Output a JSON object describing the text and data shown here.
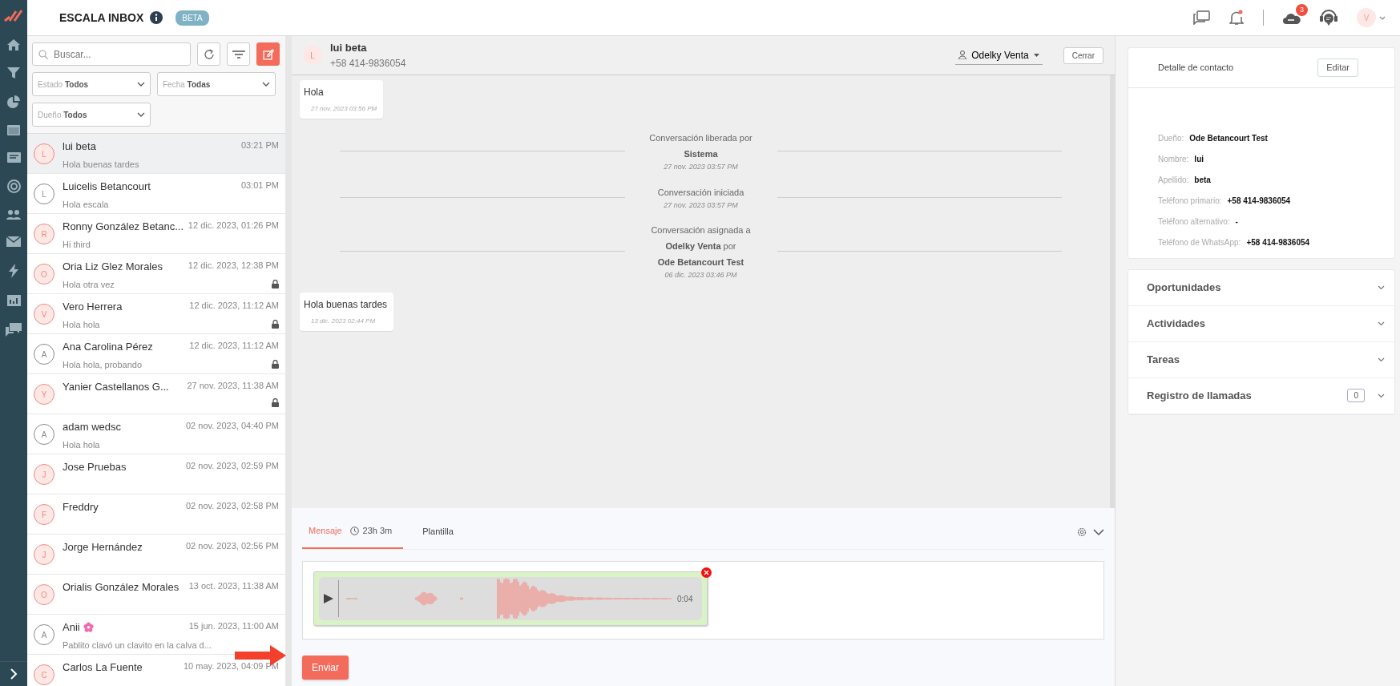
{
  "app": {
    "title": "ESCALA INBOX",
    "badge": "BETA",
    "alerts_count": "3",
    "user_initial": "V"
  },
  "conversation_list": {
    "search": {
      "placeholder": "Buscar..."
    },
    "filters": [
      {
        "label": "Estado",
        "value": "Todos"
      },
      {
        "label": "Fecha",
        "value": "Todas"
      },
      {
        "label": "Dueño",
        "value": "Todos"
      }
    ],
    "items": [
      {
        "initial": "L",
        "name": "lui beta",
        "time": "03:21 PM",
        "preview": "Hola buenas tardes",
        "color": "#f08a7e",
        "locked": false,
        "flower": false,
        "selected": true
      },
      {
        "initial": "L",
        "name": "Luicelis Betancourt",
        "time": "03:01 PM",
        "preview": "Hola escala",
        "color": "#8a8a8a",
        "locked": false,
        "flower": false,
        "selected": false
      },
      {
        "initial": "R",
        "name": "Ronny González Betanc...",
        "time": "12 dic. 2023, 01:26 PM",
        "preview": "Hi third",
        "color": "#f08a7e",
        "locked": false,
        "flower": false,
        "selected": false
      },
      {
        "initial": "O",
        "name": "Oria Liz Glez Morales",
        "time": "12 dic. 2023, 12:38 PM",
        "preview": "Hola otra vez",
        "color": "#f08a7e",
        "locked": true,
        "flower": false,
        "selected": false
      },
      {
        "initial": "V",
        "name": "Vero Herrera",
        "time": "12 dic. 2023, 11:12 AM",
        "preview": "Hola hola",
        "color": "#f08a7e",
        "locked": true,
        "flower": false,
        "selected": false
      },
      {
        "initial": "A",
        "name": "Ana Carolina Pérez",
        "time": "12 dic. 2023, 11:12 AM",
        "preview": "Hola hola, probando",
        "color": "#8a8a8a",
        "locked": true,
        "flower": false,
        "selected": false
      },
      {
        "initial": "Y",
        "name": "Yanier Castellanos G...",
        "time": "27 nov. 2023, 11:38 AM",
        "color": "#f08a7e",
        "locked": true,
        "flower": false,
        "selected": false
      },
      {
        "initial": "A",
        "name": "adam wedsc",
        "time": "02 nov. 2023, 04:40 PM",
        "preview": "Hola hola",
        "color": "#8a8a8a",
        "locked": false,
        "flower": false,
        "selected": false
      },
      {
        "initial": "J",
        "name": "Jose Pruebas",
        "time": "02 nov. 2023, 02:59 PM",
        "color": "#f08a7e",
        "locked": false,
        "flower": false,
        "selected": false
      },
      {
        "initial": "F",
        "name": "Freddry",
        "time": "02 nov. 2023, 02:58 PM",
        "color": "#f08a7e",
        "locked": false,
        "flower": false,
        "selected": false
      },
      {
        "initial": "J",
        "name": "Jorge Hernández",
        "time": "02 nov. 2023, 02:56 PM",
        "color": "#f08a7e",
        "locked": false,
        "flower": false,
        "selected": false
      },
      {
        "initial": "O",
        "name": "Orialis González Morales",
        "time": "13 oct. 2023, 11:38 AM",
        "color": "#f08a7e",
        "locked": false,
        "flower": false,
        "selected": false
      },
      {
        "initial": "A",
        "name": "Anii",
        "time": "15 jun. 2023, 11:00 AM",
        "preview": "Pablito clavó un clavito en la calva d...",
        "color": "#8a8a8a",
        "locked": false,
        "flower": true,
        "selected": false
      },
      {
        "initial": "C",
        "name": "Carlos La Fuente",
        "time": "10 may. 2023, 04:09 PM",
        "color": "#f08a7e",
        "locked": false,
        "flower": false,
        "selected": false
      }
    ]
  },
  "chat": {
    "header": {
      "initial": "L",
      "name": "lui beta",
      "phone": "+58 414-9836054",
      "assignee": "Odelky Venta",
      "close_label": "Cerrar"
    },
    "messages": [
      {
        "kind": "incoming",
        "text": "Hola",
        "time": "27 nov. 2023 03:56 PM"
      },
      {
        "kind": "event",
        "lines": [
          "Conversación liberada por",
          "**Sistema**"
        ],
        "time": "27 nov. 2023 03:57 PM"
      },
      {
        "kind": "event",
        "lines": [
          "Conversación iniciada"
        ],
        "time": "27 nov. 2023 03:57 PM"
      },
      {
        "kind": "event",
        "lines": [
          "Conversación asignada a",
          "**Odelky Venta** por",
          "**Ode Betancourt Test**"
        ],
        "time": "06 dic. 2023 03:46 PM"
      },
      {
        "kind": "incoming",
        "text": "Hola buenas tardes",
        "time": "13 dic. 2023 02:44 PM"
      }
    ],
    "composer": {
      "tabs": [
        {
          "label": "Mensaje",
          "timer": "23h 3m",
          "selected": true
        },
        {
          "label": "Plantilla",
          "selected": false
        }
      ],
      "audio": {
        "duration": "0:04"
      },
      "send_label": "Enviar"
    }
  },
  "contact": {
    "title": "Detalle de contacto",
    "edit_label": "Editar",
    "fields": [
      {
        "label": "Dueño:",
        "value": "Ode Betancourt Test"
      },
      {
        "label": "Nombre:",
        "value": "lui"
      },
      {
        "label": "Apellido:",
        "value": "beta"
      },
      {
        "label": "Teléfono primario:",
        "value": "+58 414-9836054"
      },
      {
        "label": "Teléfono alternativo:",
        "value": "-"
      },
      {
        "label": "Teléfono de WhatsApp:",
        "value": "+58 414-9836054"
      }
    ],
    "sections": [
      {
        "title": "Oportunidades"
      },
      {
        "title": "Actividades"
      },
      {
        "title": "Tareas"
      },
      {
        "title": "Registro de llamadas",
        "count": "0"
      }
    ]
  }
}
